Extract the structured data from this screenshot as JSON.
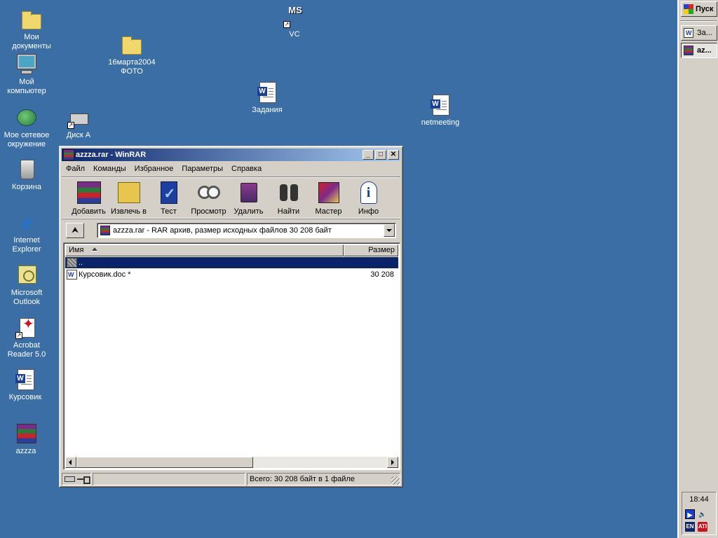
{
  "desktop": {
    "icons": [
      {
        "label": "Мои документы",
        "icon": "folder-icon"
      },
      {
        "label": "16марта2004 ФОТО",
        "icon": "folder-icon"
      },
      {
        "label": "VC",
        "icon": "ms-vc-icon"
      },
      {
        "label": "Мой компьютер",
        "icon": "computer-icon"
      },
      {
        "label": "Задания",
        "icon": "word-doc-icon"
      },
      {
        "label": "netmeeting",
        "icon": "word-doc-icon"
      },
      {
        "label": "Мое сетевое окружение",
        "icon": "network-icon"
      },
      {
        "label": "Диск А",
        "icon": "floppy-drive-icon"
      },
      {
        "label": "Корзина",
        "icon": "recycle-bin-icon"
      },
      {
        "label": "Internet Explorer",
        "icon": "ie-icon"
      },
      {
        "label": "Microsoft Outlook",
        "icon": "outlook-icon"
      },
      {
        "label": "Acrobat Reader 5.0",
        "icon": "acrobat-icon"
      },
      {
        "label": "Курсовик",
        "icon": "word-doc-icon"
      },
      {
        "label": "azzza",
        "icon": "rar-archive-icon"
      }
    ]
  },
  "vc_icon_text": "MS",
  "window": {
    "title": "azzza.rar - WinRAR",
    "controls": {
      "minimize": "_",
      "maximize": "□",
      "close": "✕"
    },
    "menu": [
      "Файл",
      "Команды",
      "Избранное",
      "Параметры",
      "Справка"
    ],
    "toolbar": [
      {
        "label": "Добавить",
        "icon": "add-archive-icon"
      },
      {
        "label": "Извлечь в",
        "icon": "extract-icon"
      },
      {
        "label": "Тест",
        "icon": "test-icon"
      },
      {
        "label": "Просмотр",
        "icon": "view-icon"
      },
      {
        "label": "Удалить",
        "icon": "delete-icon"
      },
      {
        "label": "Найти",
        "icon": "find-icon"
      },
      {
        "label": "Мастер",
        "icon": "wizard-icon"
      },
      {
        "label": "Инфо",
        "icon": "info-icon"
      }
    ],
    "path": "azzza.rar - RAR архив, размер исходных файлов 30 208 байт",
    "columns": {
      "name": "Имя",
      "size": "Размер"
    },
    "files": [
      {
        "name": "..",
        "size": "",
        "selected": true,
        "icon": "up-folder-icon"
      },
      {
        "name": "Курсовик.doc *",
        "size": "30 208",
        "selected": false,
        "icon": "word-doc-icon"
      }
    ],
    "status": {
      "total": "Всего: 30 208 байт в 1 файле"
    }
  },
  "taskbar": {
    "start_label": "Пуск",
    "buttons": [
      {
        "label": "За...",
        "icon": "word-doc-icon",
        "active": false
      },
      {
        "label": "az...",
        "icon": "rar-archive-icon",
        "active": true
      }
    ],
    "clock": "18:44",
    "tray": {
      "lang": "EN",
      "ati": "ATI"
    }
  },
  "colors": {
    "desktop": "#3a6ea5",
    "title_active_start": "#0a246a",
    "title_active_end": "#a6caf0",
    "selection": "#0a246a",
    "face": "#d4d0c8"
  }
}
